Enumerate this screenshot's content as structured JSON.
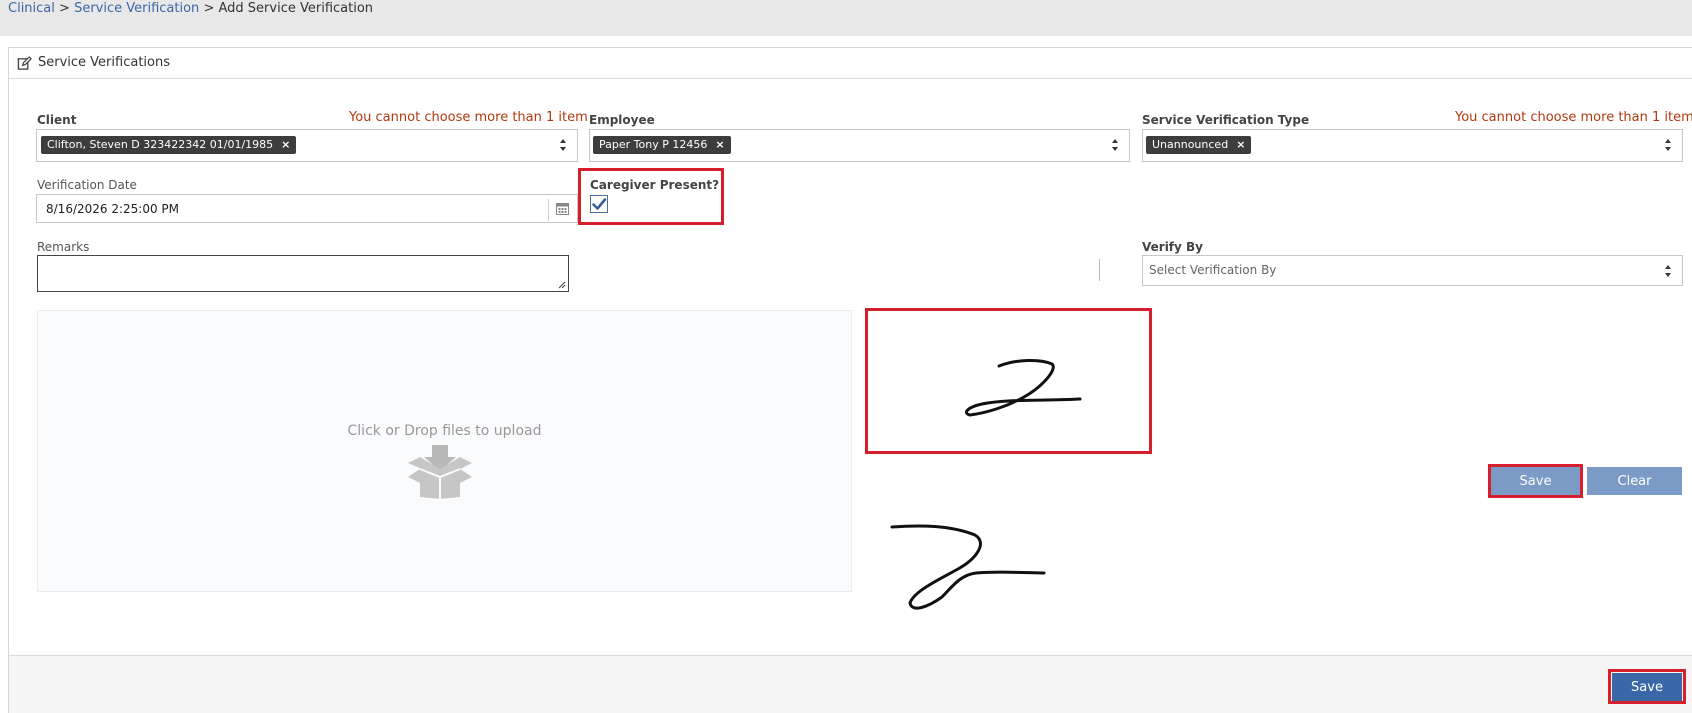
{
  "breadcrumb": {
    "items": [
      "Clinical",
      "Service Verification"
    ],
    "separator": ">",
    "current": "Add Service Verification"
  },
  "panel": {
    "title": "Service Verifications"
  },
  "form": {
    "client": {
      "label": "Client",
      "error": "You cannot choose more than 1 item",
      "tag": "Clifton, Steven D 323422342 01/01/1985"
    },
    "employee": {
      "label": "Employee",
      "tag": "Paper Tony P 12456"
    },
    "svtype": {
      "label": "Service Verification Type",
      "error": "You cannot choose more than 1 item",
      "tag": "Unannounced"
    },
    "verification_date": {
      "label": "Verification Date",
      "value": "8/16/2026 2:25:00 PM"
    },
    "caregiver_present": {
      "label": "Caregiver Present?",
      "checked": true
    },
    "remarks": {
      "label": "Remarks",
      "value": ""
    },
    "verify_by": {
      "label": "Verify By",
      "placeholder": "Select Verification By"
    },
    "upload": {
      "text": "Click or Drop files to upload"
    },
    "signature": {
      "save_label": "Save",
      "clear_label": "Clear"
    }
  },
  "footer": {
    "save_label": "Save"
  },
  "icons": {
    "edit": "edit-icon",
    "calendar": "calendar-icon",
    "upload": "box-upload-icon",
    "remove": "close-icon",
    "sort": "sort-arrows-icon",
    "check": "checkmark-icon"
  },
  "colors": {
    "link": "#3a67a8",
    "error": "#b03a10",
    "highlight": "#d61f2c",
    "button_primary": "#3a67a8",
    "button_light": "#7b9bc6",
    "tag_bg": "#3d3d3d"
  }
}
